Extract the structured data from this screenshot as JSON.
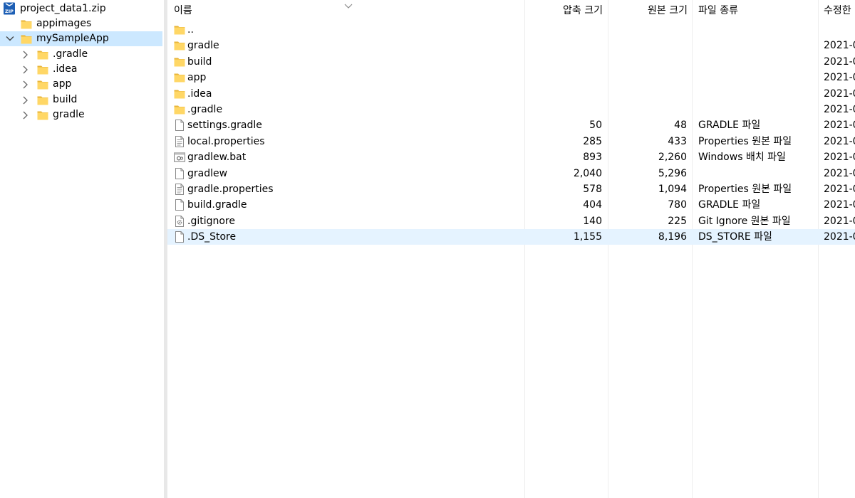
{
  "tree": {
    "root_label": "project_data1.zip",
    "root_icon": "zip-archive-icon",
    "nodes": [
      {
        "label": "appimages",
        "expandable": false,
        "expanded": false,
        "selected": false,
        "level": 1
      },
      {
        "label": "mySampleApp",
        "expandable": true,
        "expanded": true,
        "selected": true,
        "level": 1
      },
      {
        "label": ".gradle",
        "expandable": true,
        "expanded": false,
        "selected": false,
        "level": 2
      },
      {
        "label": ".idea",
        "expandable": true,
        "expanded": false,
        "selected": false,
        "level": 2
      },
      {
        "label": "app",
        "expandable": true,
        "expanded": false,
        "selected": false,
        "level": 2
      },
      {
        "label": "build",
        "expandable": true,
        "expanded": false,
        "selected": false,
        "level": 2
      },
      {
        "label": "gradle",
        "expandable": true,
        "expanded": false,
        "selected": false,
        "level": 2
      }
    ]
  },
  "list": {
    "columns": {
      "name": "이름",
      "compressed": "압축 크기",
      "original": "원본 크기",
      "type": "파일 종류",
      "modified": "수정한"
    },
    "sort_indicator": "chevron-down-icon",
    "rows": [
      {
        "icon": "folder-icon",
        "name": "..",
        "compressed": "",
        "original": "",
        "type": "",
        "modified": ""
      },
      {
        "icon": "folder-icon",
        "name": "gradle",
        "compressed": "",
        "original": "",
        "type": "",
        "modified": "2021-0"
      },
      {
        "icon": "folder-icon",
        "name": "build",
        "compressed": "",
        "original": "",
        "type": "",
        "modified": "2021-0"
      },
      {
        "icon": "folder-icon",
        "name": "app",
        "compressed": "",
        "original": "",
        "type": "",
        "modified": "2021-0"
      },
      {
        "icon": "folder-icon",
        "name": ".idea",
        "compressed": "",
        "original": "",
        "type": "",
        "modified": "2021-0"
      },
      {
        "icon": "folder-icon",
        "name": ".gradle",
        "compressed": "",
        "original": "",
        "type": "",
        "modified": "2021-0"
      },
      {
        "icon": "file-icon",
        "name": "settings.gradle",
        "compressed": "50",
        "original": "48",
        "type": "GRADLE 파일",
        "modified": "2021-0"
      },
      {
        "icon": "text-file-icon",
        "name": "local.properties",
        "compressed": "285",
        "original": "433",
        "type": "Properties 원본 파일",
        "modified": "2021-0"
      },
      {
        "icon": "batch-file-icon",
        "name": "gradlew.bat",
        "compressed": "893",
        "original": "2,260",
        "type": "Windows 배치 파일",
        "modified": "2021-0"
      },
      {
        "icon": "file-icon",
        "name": "gradlew",
        "compressed": "2,040",
        "original": "5,296",
        "type": "",
        "modified": "2021-0"
      },
      {
        "icon": "text-file-icon",
        "name": "gradle.properties",
        "compressed": "578",
        "original": "1,094",
        "type": "Properties 원본 파일",
        "modified": "2021-0"
      },
      {
        "icon": "file-icon",
        "name": "build.gradle",
        "compressed": "404",
        "original": "780",
        "type": "GRADLE 파일",
        "modified": "2021-0"
      },
      {
        "icon": "settings-file-icon",
        "name": ".gitignore",
        "compressed": "140",
        "original": "225",
        "type": "Git Ignore 원본 파일",
        "modified": "2021-0"
      },
      {
        "icon": "file-icon",
        "name": ".DS_Store",
        "compressed": "1,155",
        "original": "8,196",
        "type": "DS_STORE 파일",
        "modified": "2021-0",
        "selected": true
      }
    ]
  },
  "colors": {
    "tree_selection": "#cce8ff",
    "row_selection": "#e5f3ff",
    "folder": "#ffd766"
  }
}
